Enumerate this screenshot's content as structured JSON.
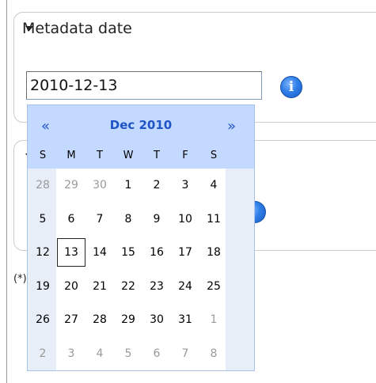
{
  "section1": {
    "title": "Metadata date",
    "date_value": "2010-12-13",
    "info_icon": "info-icon"
  },
  "section2": {
    "info_icon": "info-icon"
  },
  "required_note": "(*)",
  "calendar": {
    "prev_label": "«",
    "next_label": "»",
    "month_label": "Dec 2010",
    "weekdays": [
      "S",
      "M",
      "T",
      "W",
      "T",
      "F",
      "S"
    ],
    "weeks": [
      [
        "28",
        "29",
        "30",
        "1",
        "2",
        "3",
        "4"
      ],
      [
        "5",
        "6",
        "7",
        "8",
        "9",
        "10",
        "11"
      ],
      [
        "12",
        "13",
        "14",
        "15",
        "16",
        "17",
        "18"
      ],
      [
        "19",
        "20",
        "21",
        "22",
        "23",
        "24",
        "25"
      ],
      [
        "26",
        "27",
        "28",
        "29",
        "30",
        "31",
        "1"
      ],
      [
        "2",
        "3",
        "4",
        "5",
        "6",
        "7",
        "8"
      ]
    ],
    "other_month": [
      [
        true,
        true,
        true,
        false,
        false,
        false,
        false
      ],
      [
        false,
        false,
        false,
        false,
        false,
        false,
        false
      ],
      [
        false,
        false,
        false,
        false,
        false,
        false,
        false
      ],
      [
        false,
        false,
        false,
        false,
        false,
        false,
        false
      ],
      [
        false,
        false,
        false,
        false,
        false,
        false,
        true
      ],
      [
        true,
        true,
        true,
        true,
        true,
        true,
        true
      ]
    ],
    "selected_day": "13",
    "colors": {
      "header_bg": "#c3d9ff",
      "accent": "#1f54c7",
      "weekend_bg": "#e8eef7",
      "other_month_text": "#9a9a9a"
    }
  }
}
